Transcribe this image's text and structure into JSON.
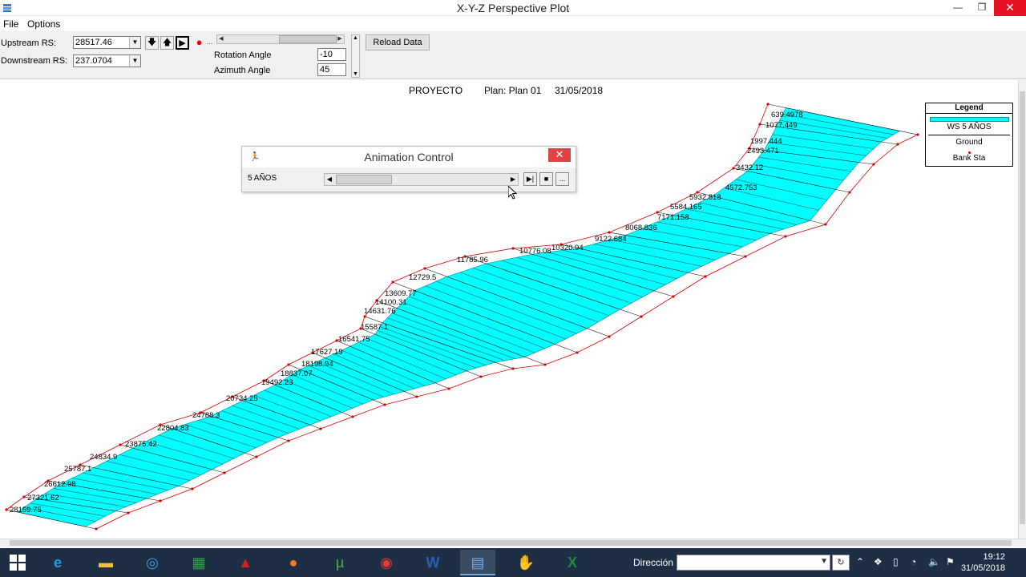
{
  "window": {
    "title": "X-Y-Z Perspective Plot",
    "minimize": "—",
    "maximize": "❐",
    "close": "✕"
  },
  "menu": {
    "file": "File",
    "options": "Options"
  },
  "toolbar": {
    "upstream_label": "Upstream RS:",
    "upstream_value": "28517.46",
    "downstream_label": "Downstream RS:",
    "downstream_value": "237.0704",
    "rotation_label": "Rotation Angle",
    "rotation_value": "-10",
    "azimuth_label": "Azimuth Angle",
    "azimuth_value": "45",
    "reload_label": "Reload Data"
  },
  "plot": {
    "project": "PROYECTO",
    "plan": "Plan: Plan 01",
    "date": "31/05/2018",
    "station_labels": [
      "639.4978",
      "1077.449",
      "1997.444",
      "2493.471",
      "3432.12",
      "4572.753",
      "5932.818",
      "5584.165",
      "7171.158",
      "8068.836",
      "9122.684",
      "10320.94",
      "10776.08",
      "11785.96",
      "12729.5",
      "13609.77",
      "14100.31",
      "14631.76",
      "15587.1",
      "16541.75",
      "17627.19",
      "18198.94",
      "18837.07",
      "19492.23",
      "20734.25",
      "24788.3",
      "22804.83",
      "23875.42",
      "24834.9",
      "25787.1",
      "26612.98",
      "27321.62",
      "28159.75"
    ]
  },
  "legend": {
    "title": "Legend",
    "ws": "WS 5 AÑOS",
    "ground": "Ground",
    "bank": "Bank Sta",
    "ws_color": "#00ffff",
    "bank_color": "#e00000"
  },
  "animation": {
    "title": "Animation Control",
    "profile": "5 AÑOS",
    "more": "..."
  },
  "taskbar": {
    "direccion_label": "Dirección",
    "time": "19:12",
    "date": "31/05/2018"
  }
}
